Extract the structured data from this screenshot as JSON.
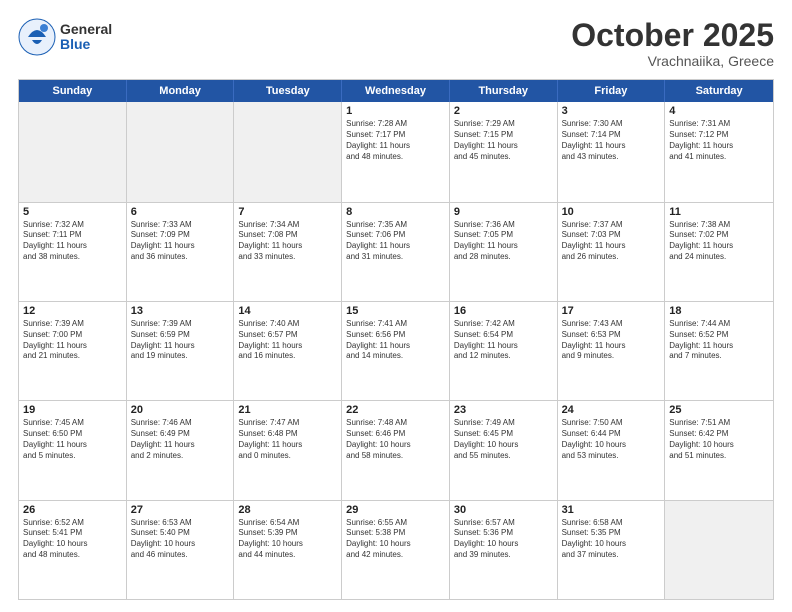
{
  "header": {
    "logo_general": "General",
    "logo_blue": "Blue",
    "month_title": "October 2025",
    "location": "Vrachnaiika, Greece"
  },
  "weekdays": [
    "Sunday",
    "Monday",
    "Tuesday",
    "Wednesday",
    "Thursday",
    "Friday",
    "Saturday"
  ],
  "rows": [
    [
      {
        "day": "",
        "info": "",
        "shaded": true
      },
      {
        "day": "",
        "info": "",
        "shaded": true
      },
      {
        "day": "",
        "info": "",
        "shaded": true
      },
      {
        "day": "1",
        "info": "Sunrise: 7:28 AM\nSunset: 7:17 PM\nDaylight: 11 hours\nand 48 minutes."
      },
      {
        "day": "2",
        "info": "Sunrise: 7:29 AM\nSunset: 7:15 PM\nDaylight: 11 hours\nand 45 minutes."
      },
      {
        "day": "3",
        "info": "Sunrise: 7:30 AM\nSunset: 7:14 PM\nDaylight: 11 hours\nand 43 minutes."
      },
      {
        "day": "4",
        "info": "Sunrise: 7:31 AM\nSunset: 7:12 PM\nDaylight: 11 hours\nand 41 minutes."
      }
    ],
    [
      {
        "day": "5",
        "info": "Sunrise: 7:32 AM\nSunset: 7:11 PM\nDaylight: 11 hours\nand 38 minutes."
      },
      {
        "day": "6",
        "info": "Sunrise: 7:33 AM\nSunset: 7:09 PM\nDaylight: 11 hours\nand 36 minutes."
      },
      {
        "day": "7",
        "info": "Sunrise: 7:34 AM\nSunset: 7:08 PM\nDaylight: 11 hours\nand 33 minutes."
      },
      {
        "day": "8",
        "info": "Sunrise: 7:35 AM\nSunset: 7:06 PM\nDaylight: 11 hours\nand 31 minutes."
      },
      {
        "day": "9",
        "info": "Sunrise: 7:36 AM\nSunset: 7:05 PM\nDaylight: 11 hours\nand 28 minutes."
      },
      {
        "day": "10",
        "info": "Sunrise: 7:37 AM\nSunset: 7:03 PM\nDaylight: 11 hours\nand 26 minutes."
      },
      {
        "day": "11",
        "info": "Sunrise: 7:38 AM\nSunset: 7:02 PM\nDaylight: 11 hours\nand 24 minutes."
      }
    ],
    [
      {
        "day": "12",
        "info": "Sunrise: 7:39 AM\nSunset: 7:00 PM\nDaylight: 11 hours\nand 21 minutes."
      },
      {
        "day": "13",
        "info": "Sunrise: 7:39 AM\nSunset: 6:59 PM\nDaylight: 11 hours\nand 19 minutes."
      },
      {
        "day": "14",
        "info": "Sunrise: 7:40 AM\nSunset: 6:57 PM\nDaylight: 11 hours\nand 16 minutes."
      },
      {
        "day": "15",
        "info": "Sunrise: 7:41 AM\nSunset: 6:56 PM\nDaylight: 11 hours\nand 14 minutes."
      },
      {
        "day": "16",
        "info": "Sunrise: 7:42 AM\nSunset: 6:54 PM\nDaylight: 11 hours\nand 12 minutes."
      },
      {
        "day": "17",
        "info": "Sunrise: 7:43 AM\nSunset: 6:53 PM\nDaylight: 11 hours\nand 9 minutes."
      },
      {
        "day": "18",
        "info": "Sunrise: 7:44 AM\nSunset: 6:52 PM\nDaylight: 11 hours\nand 7 minutes."
      }
    ],
    [
      {
        "day": "19",
        "info": "Sunrise: 7:45 AM\nSunset: 6:50 PM\nDaylight: 11 hours\nand 5 minutes."
      },
      {
        "day": "20",
        "info": "Sunrise: 7:46 AM\nSunset: 6:49 PM\nDaylight: 11 hours\nand 2 minutes."
      },
      {
        "day": "21",
        "info": "Sunrise: 7:47 AM\nSunset: 6:48 PM\nDaylight: 11 hours\nand 0 minutes."
      },
      {
        "day": "22",
        "info": "Sunrise: 7:48 AM\nSunset: 6:46 PM\nDaylight: 10 hours\nand 58 minutes."
      },
      {
        "day": "23",
        "info": "Sunrise: 7:49 AM\nSunset: 6:45 PM\nDaylight: 10 hours\nand 55 minutes."
      },
      {
        "day": "24",
        "info": "Sunrise: 7:50 AM\nSunset: 6:44 PM\nDaylight: 10 hours\nand 53 minutes."
      },
      {
        "day": "25",
        "info": "Sunrise: 7:51 AM\nSunset: 6:42 PM\nDaylight: 10 hours\nand 51 minutes."
      }
    ],
    [
      {
        "day": "26",
        "info": "Sunrise: 6:52 AM\nSunset: 5:41 PM\nDaylight: 10 hours\nand 48 minutes."
      },
      {
        "day": "27",
        "info": "Sunrise: 6:53 AM\nSunset: 5:40 PM\nDaylight: 10 hours\nand 46 minutes."
      },
      {
        "day": "28",
        "info": "Sunrise: 6:54 AM\nSunset: 5:39 PM\nDaylight: 10 hours\nand 44 minutes."
      },
      {
        "day": "29",
        "info": "Sunrise: 6:55 AM\nSunset: 5:38 PM\nDaylight: 10 hours\nand 42 minutes."
      },
      {
        "day": "30",
        "info": "Sunrise: 6:57 AM\nSunset: 5:36 PM\nDaylight: 10 hours\nand 39 minutes."
      },
      {
        "day": "31",
        "info": "Sunrise: 6:58 AM\nSunset: 5:35 PM\nDaylight: 10 hours\nand 37 minutes."
      },
      {
        "day": "",
        "info": "",
        "shaded": true
      }
    ]
  ]
}
